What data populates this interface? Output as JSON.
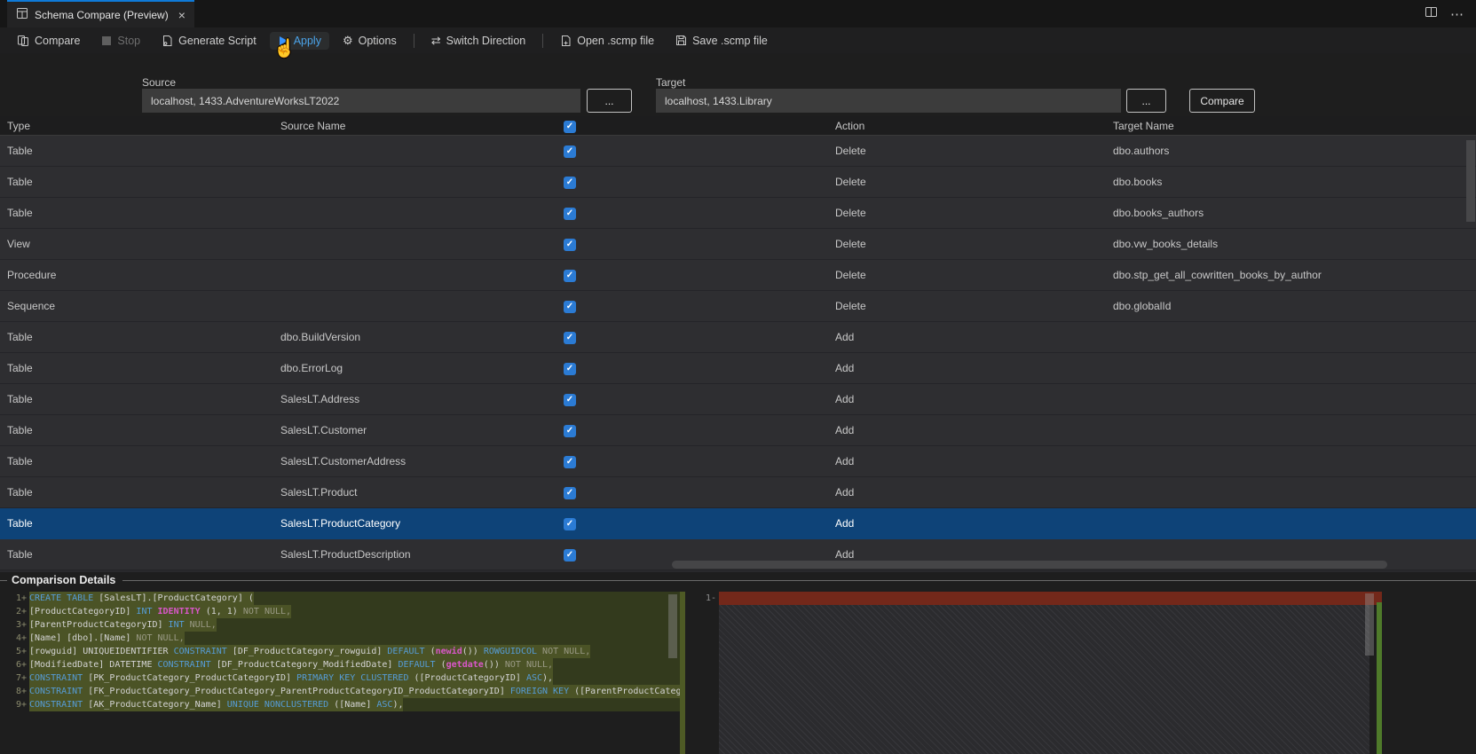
{
  "tab": {
    "title": "Schema Compare (Preview)",
    "close": "×"
  },
  "window": {
    "more": "⋯"
  },
  "toolbar": {
    "items": [
      {
        "label": "Compare",
        "icon": "compare-icon",
        "enabled": true,
        "active": false
      },
      {
        "label": "Stop",
        "icon": "stop-icon",
        "enabled": false,
        "active": false
      },
      {
        "label": "Generate Script",
        "icon": "script-icon",
        "enabled": true,
        "active": false
      },
      {
        "label": "Apply",
        "icon": "play-icon",
        "enabled": true,
        "active": true
      },
      {
        "label": "Options",
        "icon": "gear-icon",
        "enabled": true,
        "active": false
      },
      {
        "label": "Switch Direction",
        "icon": "switch-direction-icon",
        "enabled": true,
        "active": false
      },
      {
        "label": "Open .scmp file",
        "icon": "open-file-icon",
        "enabled": true,
        "active": false
      },
      {
        "label": "Save .scmp file",
        "icon": "save-icon",
        "enabled": true,
        "active": false
      }
    ],
    "gear_glyph": "⚙",
    "switch_glyph": "⇄"
  },
  "connection": {
    "source_label": "Source",
    "source_value": "localhost, 1433.AdventureWorksLT2022",
    "target_label": "Target",
    "target_value": "localhost, 1433.Library",
    "browse_label": "...",
    "compare_label": "Compare"
  },
  "grid": {
    "columns": [
      "Type",
      "Source Name",
      "Action",
      "Target Name"
    ],
    "rows": [
      {
        "type": "Table",
        "source": "",
        "checked": true,
        "action": "Delete",
        "target": "dbo.authors",
        "selected": false
      },
      {
        "type": "Table",
        "source": "",
        "checked": true,
        "action": "Delete",
        "target": "dbo.books",
        "selected": false
      },
      {
        "type": "Table",
        "source": "",
        "checked": true,
        "action": "Delete",
        "target": "dbo.books_authors",
        "selected": false
      },
      {
        "type": "View",
        "source": "",
        "checked": true,
        "action": "Delete",
        "target": "dbo.vw_books_details",
        "selected": false
      },
      {
        "type": "Procedure",
        "source": "",
        "checked": true,
        "action": "Delete",
        "target": "dbo.stp_get_all_cowritten_books_by_author",
        "selected": false
      },
      {
        "type": "Sequence",
        "source": "",
        "checked": true,
        "action": "Delete",
        "target": "dbo.globalId",
        "selected": false
      },
      {
        "type": "Table",
        "source": "dbo.BuildVersion",
        "checked": true,
        "action": "Add",
        "target": "",
        "selected": false
      },
      {
        "type": "Table",
        "source": "dbo.ErrorLog",
        "checked": true,
        "action": "Add",
        "target": "",
        "selected": false
      },
      {
        "type": "Table",
        "source": "SalesLT.Address",
        "checked": true,
        "action": "Add",
        "target": "",
        "selected": false
      },
      {
        "type": "Table",
        "source": "SalesLT.Customer",
        "checked": true,
        "action": "Add",
        "target": "",
        "selected": false
      },
      {
        "type": "Table",
        "source": "SalesLT.CustomerAddress",
        "checked": true,
        "action": "Add",
        "target": "",
        "selected": false
      },
      {
        "type": "Table",
        "source": "SalesLT.Product",
        "checked": true,
        "action": "Add",
        "target": "",
        "selected": false
      },
      {
        "type": "Table",
        "source": "SalesLT.ProductCategory",
        "checked": true,
        "action": "Add",
        "target": "",
        "selected": true
      },
      {
        "type": "Table",
        "source": "SalesLT.ProductDescription",
        "checked": true,
        "action": "Add",
        "target": "",
        "selected": false
      }
    ]
  },
  "details": {
    "title": "Comparison Details",
    "left": {
      "lines": [
        {
          "n": "1+",
          "toks": [
            [
              "CREATE TABLE ",
              "kw"
            ],
            [
              "[SalesLT].[ProductCategory] (",
              "id"
            ]
          ]
        },
        {
          "n": "2+",
          "toks": [
            [
              "[ProductCategoryID] ",
              "id"
            ],
            [
              "INT ",
              "kw"
            ],
            [
              "IDENTITY ",
              "fn"
            ],
            [
              "(1, 1) ",
              "id"
            ],
            [
              "NOT NULL,",
              "dim"
            ]
          ]
        },
        {
          "n": "3+",
          "toks": [
            [
              "[ParentProductCategoryID] ",
              "id"
            ],
            [
              "INT ",
              "kw"
            ],
            [
              "NULL,",
              "dim"
            ]
          ]
        },
        {
          "n": "4+",
          "toks": [
            [
              "[Name] [dbo].[Name] ",
              "id"
            ],
            [
              "NOT NULL,",
              "dim"
            ]
          ]
        },
        {
          "n": "5+",
          "toks": [
            [
              "[rowguid] UNIQUEIDENTIFIER ",
              "id"
            ],
            [
              "CONSTRAINT ",
              "kw"
            ],
            [
              "[DF_ProductCategory_rowguid] ",
              "id"
            ],
            [
              "DEFAULT ",
              "kw"
            ],
            [
              "(",
              "id"
            ],
            [
              "newid",
              "fn"
            ],
            [
              "()) ",
              "id"
            ],
            [
              "ROWGUIDCOL ",
              "kw"
            ],
            [
              "NOT NULL,",
              "dim"
            ]
          ]
        },
        {
          "n": "6+",
          "toks": [
            [
              "[ModifiedDate] DATETIME ",
              "id"
            ],
            [
              "CONSTRAINT ",
              "kw"
            ],
            [
              "[DF_ProductCategory_ModifiedDate] ",
              "id"
            ],
            [
              "DEFAULT ",
              "kw"
            ],
            [
              "(",
              "id"
            ],
            [
              "getdate",
              "fn"
            ],
            [
              "()) ",
              "id"
            ],
            [
              "NOT NULL,",
              "dim"
            ]
          ]
        },
        {
          "n": "7+",
          "toks": [
            [
              "CONSTRAINT ",
              "kw"
            ],
            [
              "[PK_ProductCategory_ProductCategoryID] ",
              "id"
            ],
            [
              "PRIMARY KEY CLUSTERED ",
              "kw"
            ],
            [
              "([ProductCategoryID] ",
              "id"
            ],
            [
              "ASC",
              "kw"
            ],
            [
              "),",
              "id"
            ]
          ]
        },
        {
          "n": "8+",
          "toks": [
            [
              "CONSTRAINT ",
              "kw"
            ],
            [
              "[FK_ProductCategory_ProductCategory_ParentProductCategoryID_ProductCategoryID] ",
              "id"
            ],
            [
              "FOREIGN KEY ",
              "kw"
            ],
            [
              "([ParentProductCatego",
              "id"
            ]
          ]
        },
        {
          "n": "9+",
          "toks": [
            [
              "CONSTRAINT ",
              "kw"
            ],
            [
              "[AK_ProductCategory_Name] ",
              "id"
            ],
            [
              "UNIQUE NONCLUSTERED ",
              "kw"
            ],
            [
              "([Name] ",
              "id"
            ],
            [
              "ASC",
              "kw"
            ],
            [
              "),",
              "id"
            ]
          ]
        }
      ]
    },
    "right": {
      "lines": [
        {
          "n": "1-",
          "removed": true
        }
      ]
    }
  },
  "colors": {
    "accent_tab_border": "#0f7ad8",
    "checkbox_blue": "#2b7bd4",
    "selected_row": "#0e4378",
    "added_line_bg": "#333a1d",
    "added_char_bg": "#4b5326",
    "removed_line_bg": "#73281a",
    "keyword": "#569cd6",
    "function_magenta": "#d957c9"
  }
}
